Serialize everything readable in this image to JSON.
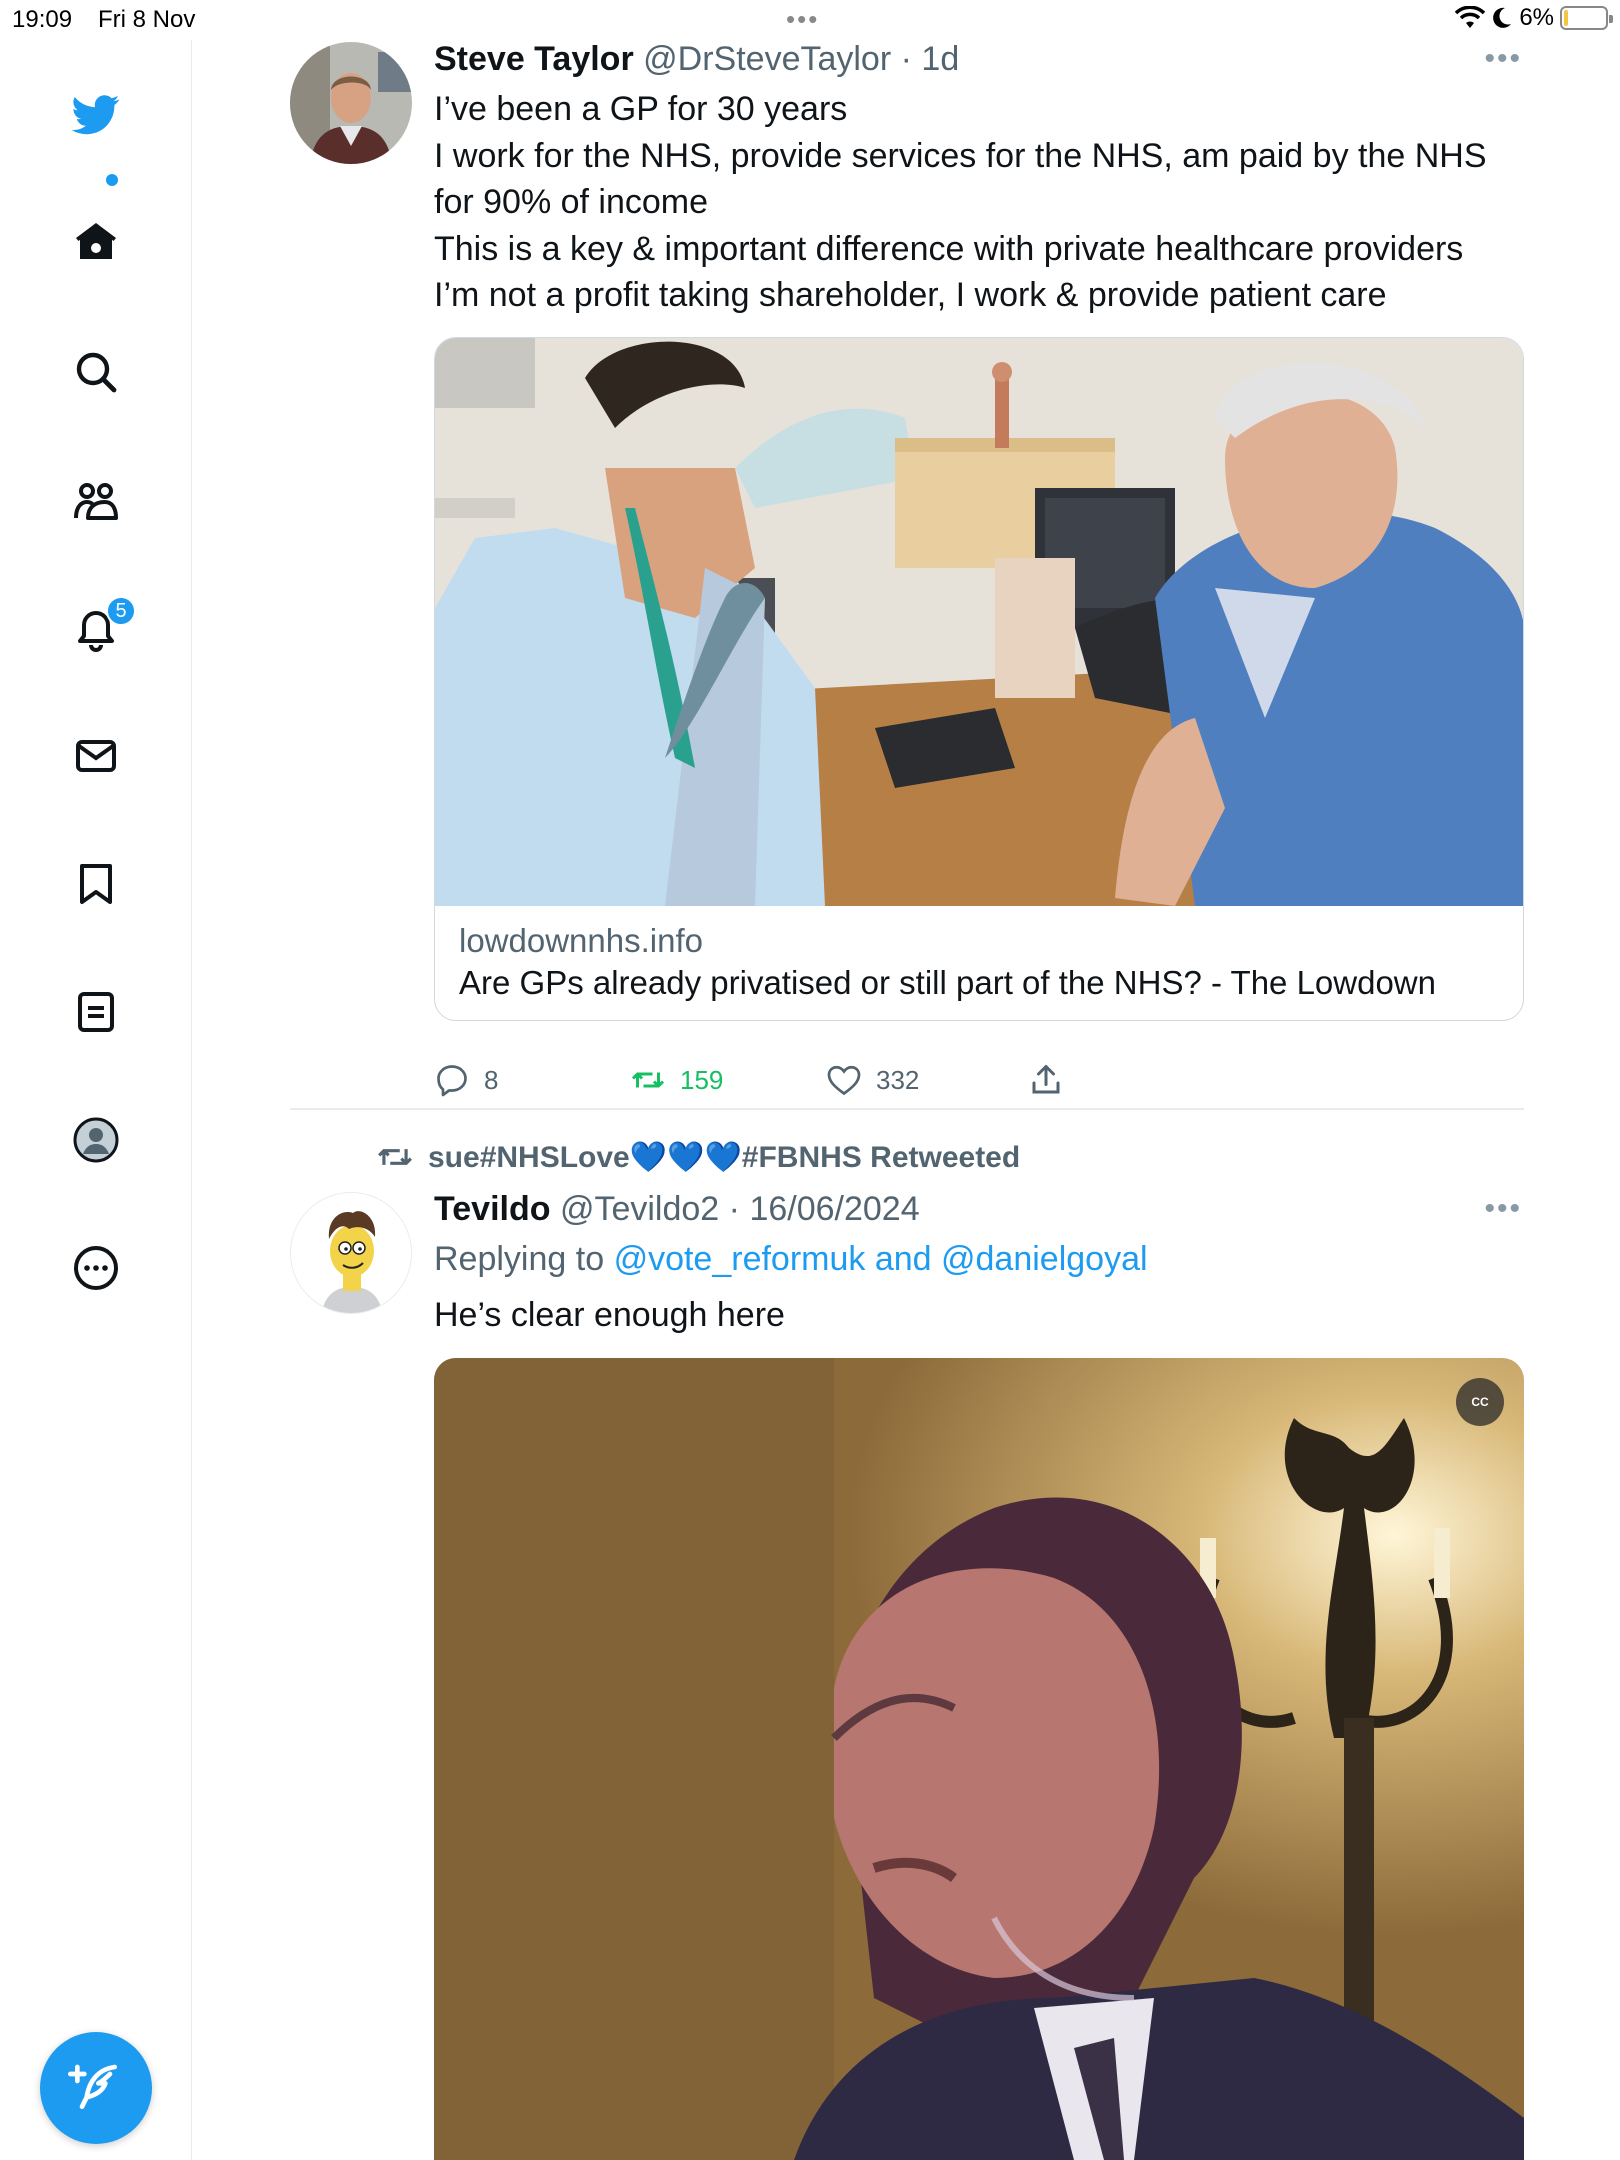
{
  "status_bar": {
    "time": "19:09",
    "date": "Fri 8 Nov",
    "battery": "6%",
    "battery_level": 0.06
  },
  "sidebar": {
    "items": [
      {
        "icon": "twitter-bird-icon"
      },
      {
        "icon": "home-icon"
      },
      {
        "icon": "search-icon"
      },
      {
        "icon": "communities-icon"
      },
      {
        "icon": "bell-icon"
      },
      {
        "icon": "mail-icon"
      },
      {
        "icon": "bookmark-icon"
      },
      {
        "icon": "lists-icon"
      },
      {
        "icon": "profile-icon"
      },
      {
        "icon": "more-icon"
      }
    ],
    "notification_count": "5",
    "compose_icon": "compose-icon",
    "accent": "#1d9bf0"
  },
  "tweet1": {
    "name": "Steve Taylor",
    "handle": "@DrSteveTaylor",
    "sep": "·",
    "time": "1d",
    "lines": [
      "I’ve been a GP for 30 years",
      "I work for the NHS, provide services for the NHS, am paid by the NHS",
      "for 90% of income",
      "This is a key & important difference with private healthcare providers",
      "I’m not a profit taking shareholder, I work & provide patient care"
    ],
    "card": {
      "domain": "lowdownnhs.info",
      "title": "Are GPs already privatised or still part of the NHS? - The Lowdown"
    },
    "replies": "8",
    "retweets": "159",
    "likes": "332"
  },
  "tweet2": {
    "retweeted_by": "sue#NHSLove💙💙💙#FBNHS Retweeted",
    "name": "Tevildo",
    "handle": "@Tevildo2",
    "sep": "·",
    "time": "16/06/2024",
    "replying_prefix": "Replying to",
    "replying_to": "@vote_reformuk and @danielgoyal",
    "text": "He’s clear enough here",
    "cc_label": "CC"
  }
}
